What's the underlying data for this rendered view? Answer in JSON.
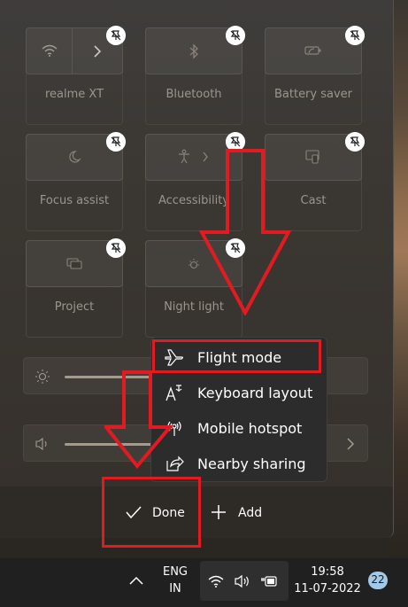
{
  "quick_settings": {
    "tiles": [
      {
        "label": "realme XT",
        "icon": "wifi-icon"
      },
      {
        "label": "Bluetooth",
        "icon": "bluetooth-icon"
      },
      {
        "label": "Battery saver",
        "icon": "battery-saver-icon"
      },
      {
        "label": "Focus assist",
        "icon": "moon-icon"
      },
      {
        "label": "Accessibility",
        "icon": "accessibility-icon"
      },
      {
        "label": "Cast",
        "icon": "cast-icon"
      },
      {
        "label": "Project",
        "icon": "project-icon"
      },
      {
        "label": "Night light",
        "icon": "night-light-icon"
      }
    ],
    "pin_icon": "unpin-icon"
  },
  "add_menu": {
    "items": [
      {
        "label": "Flight mode",
        "icon": "airplane-icon"
      },
      {
        "label": "Keyboard layout",
        "icon": "keyboard-layout-icon"
      },
      {
        "label": "Mobile hotspot",
        "icon": "hotspot-icon"
      },
      {
        "label": "Nearby sharing",
        "icon": "nearby-sharing-icon"
      }
    ]
  },
  "footer": {
    "done_label": "Done",
    "add_label": "Add"
  },
  "taskbar": {
    "language_line1": "ENG",
    "language_line2": "IN",
    "time": "19:58",
    "date": "11-07-2022",
    "notification_count": "22"
  },
  "annotation_color": "#e21b23"
}
